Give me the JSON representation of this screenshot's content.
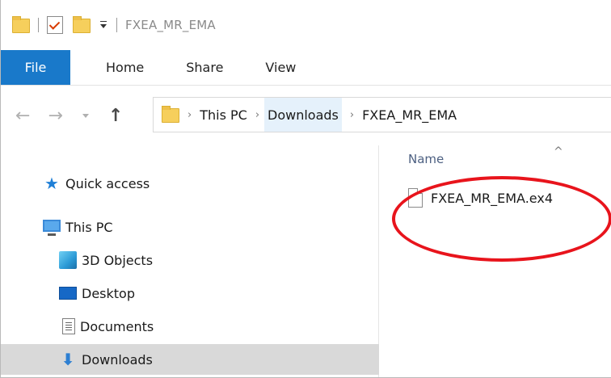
{
  "window": {
    "title": "FXEA_MR_EMA"
  },
  "ribbon": {
    "tabs": [
      "File",
      "Home",
      "Share",
      "View"
    ]
  },
  "navigation": {
    "back_icon": "back-arrow-icon",
    "forward_icon": "forward-arrow-icon",
    "recent_icon": "chevron-down-icon",
    "up_icon": "up-arrow-icon"
  },
  "address": {
    "breadcrumbs": [
      "This PC",
      "Downloads",
      "FXEA_MR_EMA"
    ]
  },
  "sidebar": {
    "items": [
      {
        "label": "Quick access",
        "icon": "star-icon",
        "selected": false
      },
      {
        "label": "This PC",
        "icon": "monitor-icon",
        "selected": false
      },
      {
        "label": "3D Objects",
        "icon": "cube-icon",
        "selected": false
      },
      {
        "label": "Desktop",
        "icon": "desktop-icon",
        "selected": false
      },
      {
        "label": "Documents",
        "icon": "document-icon",
        "selected": false
      },
      {
        "label": "Downloads",
        "icon": "download-icon",
        "selected": true
      }
    ]
  },
  "content": {
    "column_header": "Name",
    "files": [
      {
        "name": "FXEA_MR_EMA.ex4",
        "icon": "file-icon"
      }
    ]
  },
  "colors": {
    "file_tab": "#1979ca",
    "selection": "#d9d9d9",
    "breadcrumb_highlight": "#e5f1fb",
    "annotation_circle": "#e8141c"
  }
}
